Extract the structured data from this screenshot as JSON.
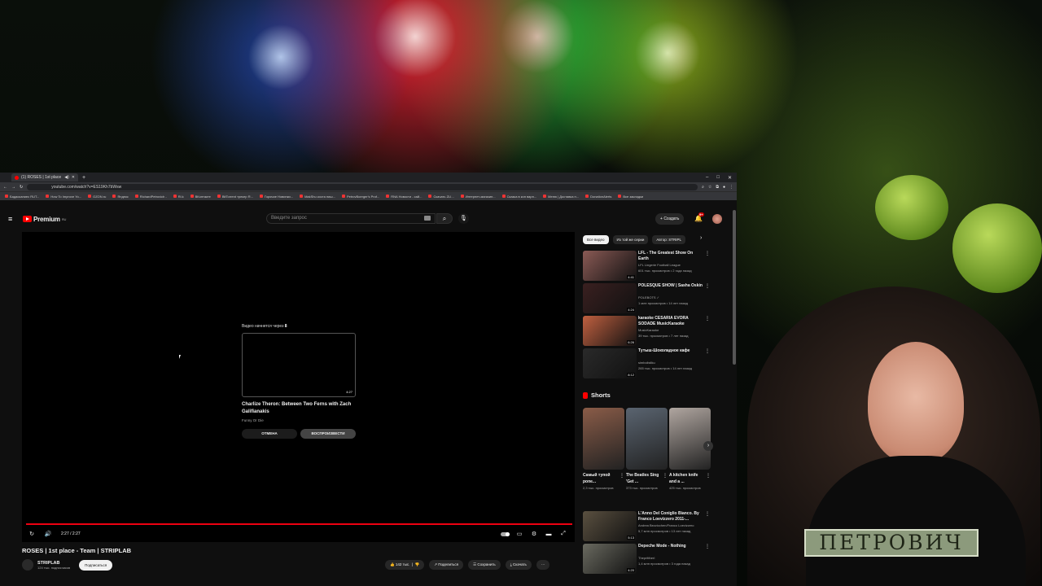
{
  "stream": {
    "overlay_name": "ПЕТРОВИЧ"
  },
  "browser": {
    "tab_title": "(1) ROSES | 1st place - Team",
    "tab_sound": "◀)",
    "new_tab": "+",
    "url": "youtube.com/watch?v=ES19Kh7bWsw",
    "bookmarks": [
      "Бадасканиес RUT...",
      "How To Improve Yo...",
      "OZON.ru",
      "Яндекс",
      "RichardPetrovich -",
      "Ri.k",
      "ВКонтакте",
      "BitTorrent трекер R...",
      "Горячие Новинки...",
      "MakShu коста пиш...",
      "PetrovBoerger's Prof...",
      "RNA Новости - сай...",
      "Скачать ZLI...",
      "Интернет-магазин...",
      "Сказка в кон варн...",
      "Меню | Доставка н...",
      "DonationAlerts",
      "Все закладки"
    ]
  },
  "youtube": {
    "logo": "Premium",
    "region": "RU",
    "search_placeholder": "Введите запрос",
    "create_label": "Создать",
    "notifications": "9+",
    "player": {
      "upnext_prefix": "Видео начнется через",
      "upnext_seconds": "8",
      "upnext_duration": "4:27",
      "upnext_title": "Charlize Theron: Between Two Ferns with Zach Galifianakis",
      "upnext_channel": "Funny Or Die",
      "cancel_label": "ОТМЕНА",
      "play_label": "ВОСПРОИЗВЕСТИ",
      "time": "2:27 / 2:27",
      "progress": 1.0
    },
    "video_title": "ROSES | 1st place - Team | STRIPLAB",
    "channel_name": "STRIPLAB",
    "channel_subs": "124 тыс. подписчиков",
    "subscribe_label": "Подписаться",
    "actions": {
      "likes": "142 тыс.",
      "share": "Поделиться",
      "save": "Сохранить",
      "download": "Скачать"
    },
    "chips": [
      "Все видео",
      "Из той же серии",
      "Автор: STRIPL"
    ],
    "recommendations": [
      {
        "title": "LFL - The Greatest Show On Earth",
        "channel": "LFL Lingerie Football League",
        "meta": "601 тыс. просмотров • 2 года назад",
        "duration": "4:41",
        "color": "#8a5a55"
      },
      {
        "title": "POLESQUE SHOW | Sasha Oskin",
        "channel": "POLEBOTS ✓",
        "meta": "1 млн просмотров • 14 лет назад",
        "duration": "4:24",
        "color": "#3a2020"
      },
      {
        "title": "karaoke CESARIA EVORA SODADE MusicKaraoke",
        "channel": "MusicKaraoke",
        "meta": "39 тыс. просмотров • 7 лет назад",
        "duration": "6:26",
        "color": "#c06040"
      },
      {
        "title": "Тутыш-Шоколадное кафе",
        "channel": "simbolistiku",
        "meta": "265 тыс. просмотров • 14 лет назад",
        "duration": "8:12",
        "color": "#2a2a2a"
      }
    ],
    "shorts_title": "Shorts",
    "shorts": [
      {
        "title": "Самый тупой ропе...",
        "views": "2,3 тыс. просмотров",
        "color": "#8a5c48"
      },
      {
        "title": "The Beatles Sing 'Get ...",
        "views": "373 тыс. просмотров",
        "color": "#5a6470"
      },
      {
        "title": "A kitchen knife and a ...",
        "views": "425 тыс. просмотров",
        "color": "#b0a6a0"
      }
    ],
    "more_recommendations": [
      {
        "title": "L'Anno Del Coniglio Bianco. By Franco Loevizzero 2011-...",
        "channel": "Andrea Bezzicchen/Franco Loevizzero",
        "meta": "5,7 млн просмотров • 13 лет назад",
        "duration": "5:13",
        "color": "#5a5040"
      },
      {
        "title": "Depeche Mode - Nothing",
        "channel": "TheprittherI",
        "meta": "1,4 млн просмотров • 3 года назад",
        "duration": "4:20",
        "color": "#6a6a60"
      }
    ]
  }
}
